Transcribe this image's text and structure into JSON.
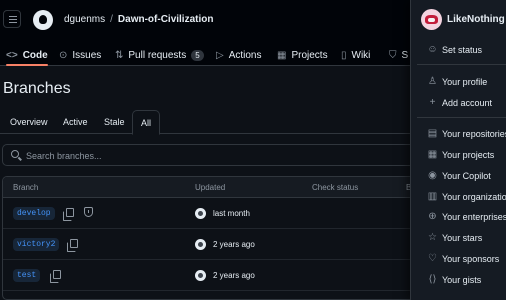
{
  "header": {
    "owner": "dguenms",
    "separator": "/",
    "repo": "Dawn-of-Civilization"
  },
  "reponav": [
    {
      "label": "Code",
      "icon": "<>",
      "icon_name": "code-icon"
    },
    {
      "label": "Issues",
      "icon": "⊙",
      "icon_name": "issue-icon"
    },
    {
      "label": "Pull requests",
      "icon": "⇅",
      "icon_name": "pull-request-icon",
      "count": "5"
    },
    {
      "label": "Actions",
      "icon": "▷",
      "icon_name": "actions-icon"
    },
    {
      "label": "Projects",
      "icon": "▦",
      "icon_name": "projects-icon"
    },
    {
      "label": "Wiki",
      "icon": "▯",
      "icon_name": "wiki-icon"
    },
    {
      "label": "S",
      "icon": "⛉",
      "icon_name": "security-icon"
    }
  ],
  "page": {
    "title": "Branches"
  },
  "tabs": [
    "Overview",
    "Active",
    "Stale",
    "All"
  ],
  "search": {
    "placeholder": "Search branches..."
  },
  "table": {
    "columns": [
      "Branch",
      "Updated",
      "Check status",
      "B"
    ],
    "rows": [
      {
        "branch": "develop",
        "updated": "last month"
      },
      {
        "branch": "victory2",
        "updated": "2 years ago"
      },
      {
        "branch": "test",
        "updated": "2 years ago"
      }
    ]
  },
  "user_menu": {
    "username": "LikeNothing",
    "status": "Set status",
    "items": [
      {
        "label": "Your profile",
        "icon": "♙",
        "icon_name": "person-icon"
      },
      {
        "label": "Add account",
        "icon": "+",
        "icon_name": "person-add-icon"
      },
      {
        "label": "Your repositories",
        "icon": "▤",
        "icon_name": "repo-icon"
      },
      {
        "label": "Your projects",
        "icon": "▦",
        "icon_name": "table-icon"
      },
      {
        "label": "Your Copilot",
        "icon": "◉",
        "icon_name": "copilot-icon"
      },
      {
        "label": "Your organizations",
        "icon": "▥",
        "icon_name": "organization-icon"
      },
      {
        "label": "Your enterprises",
        "icon": "⊕",
        "icon_name": "globe-icon"
      },
      {
        "label": "Your stars",
        "icon": "☆",
        "icon_name": "star-icon"
      },
      {
        "label": "Your sponsors",
        "icon": "♡",
        "icon_name": "heart-icon"
      },
      {
        "label": "Your gists",
        "icon": "⟨⟩",
        "icon_name": "code-square-icon"
      }
    ]
  }
}
